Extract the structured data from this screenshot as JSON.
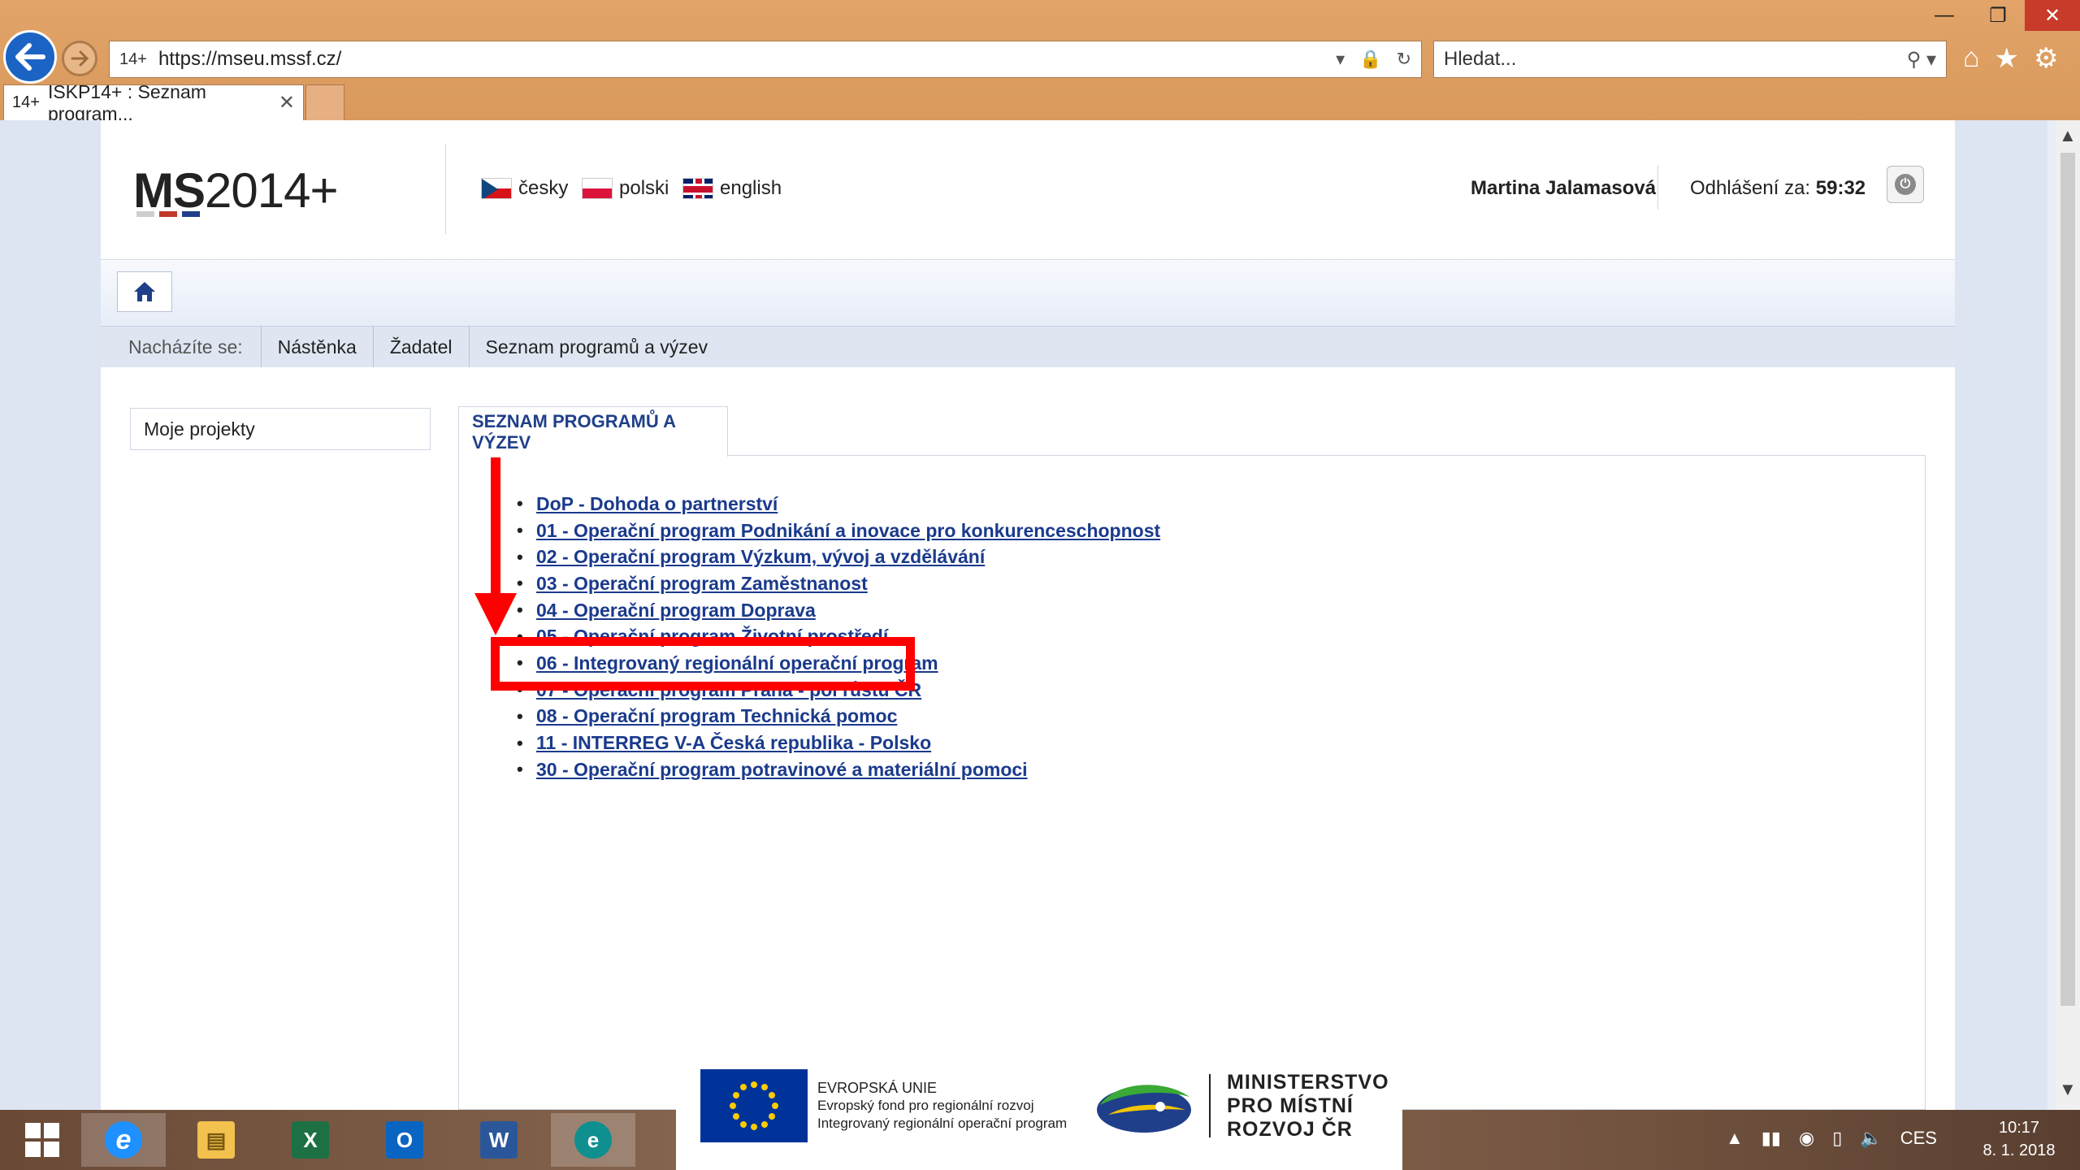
{
  "browser": {
    "url": "https://mseu.mssf.cz/",
    "search_placeholder": "Hledat...",
    "tab_title": "ISKP14+ : Seznam program...",
    "favicon_text": "14+"
  },
  "header": {
    "logo_bold": "MS",
    "logo_rest": "2014+",
    "languages": [
      {
        "label": "česky",
        "flag": "cz"
      },
      {
        "label": "polski",
        "flag": "pl"
      },
      {
        "label": "english",
        "flag": "gb"
      }
    ],
    "user_name": "Martina Jalamasová",
    "logout_label": "Odhlášení za:",
    "logout_time": "59:32"
  },
  "breadcrumb": {
    "label": "Nacházíte se:",
    "items": [
      "Nástěnka",
      "Žadatel",
      "Seznam programů a výzev"
    ]
  },
  "sidebar": {
    "my_projects": "Moje projekty"
  },
  "main": {
    "tab_title": "SEZNAM PROGRAMŮ A VÝZEV",
    "programs": [
      "DoP - Dohoda o partnerství",
      "01 - Operační program Podnikání a inovace pro konkurenceschopnost",
      "02 - Operační program Výzkum, vývoj a vzdělávání",
      "03 - Operační program Zaměstnanost",
      "04 - Operační program Doprava",
      "05 - Operační program Životní prostředí",
      "06 - Integrovaný regionální operační program",
      "07 - Operační program Praha - pól růstu ČR",
      "08 - Operační program Technická pomoc",
      "11 - INTERREG V-A Česká republika - Polsko",
      "30 - Operační program potravinové a materiální pomoci"
    ]
  },
  "footer": {
    "eu_line1": "EVROPSKÁ UNIE",
    "eu_line2": "Evropský fond pro regionální rozvoj",
    "eu_line3": "Integrovaný regionální operační program",
    "mmr_line1": "MINISTERSTVO",
    "mmr_line2": "PRO MÍSTNÍ",
    "mmr_line3": "ROZVOJ ČR"
  },
  "taskbar": {
    "language": "CES",
    "time": "10:17",
    "date": "8. 1. 2018"
  },
  "colors": {
    "link": "#1a3a8c",
    "highlight": "#ff0000",
    "chrome": "#e2a469"
  }
}
